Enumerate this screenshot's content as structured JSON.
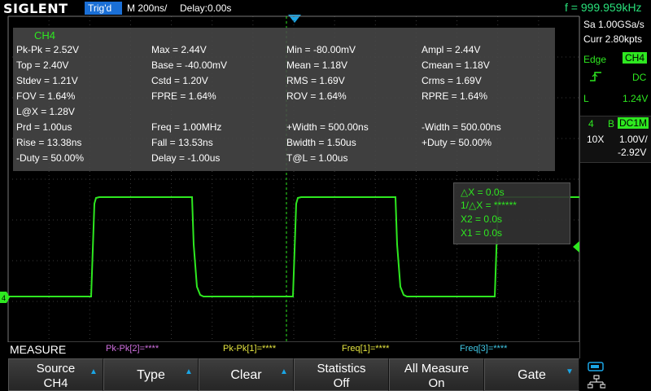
{
  "header": {
    "brand": "SIGLENT",
    "trigger_status": "Trig'd",
    "timebase": "M 200ns/",
    "delay": "Delay:0.00s",
    "frequency": "f = 999.959kHz"
  },
  "measurements": {
    "channel": "CH4",
    "rows": [
      [
        "Pk-Pk = 2.52V",
        "Max = 2.44V",
        "Min = -80.00mV",
        "Ampl = 2.44V"
      ],
      [
        "Top = 2.40V",
        "Base = -40.00mV",
        "Mean = 1.18V",
        "Cmean = 1.18V"
      ],
      [
        "Stdev = 1.21V",
        "Cstd = 1.20V",
        "RMS = 1.69V",
        "Crms = 1.69V"
      ],
      [
        "FOV = 1.64%",
        "FPRE = 1.64%",
        "ROV = 1.64%",
        "RPRE = 1.64%"
      ],
      [
        "L@X = 1.28V",
        "",
        "",
        ""
      ],
      [
        "Prd = 1.00us",
        "Freq = 1.00MHz",
        "+Width = 500.00ns",
        "-Width = 500.00ns"
      ],
      [
        "Rise = 13.38ns",
        "Fall = 13.53ns",
        "Bwidth = 1.50us",
        "+Duty = 50.00%"
      ],
      [
        "-Duty = 50.00%",
        "Delay = -1.00us",
        "T@L = 1.00us",
        ""
      ]
    ]
  },
  "cursors": {
    "delta_x": "△X = 0.0s",
    "inv_delta_x": "1/△X = ******",
    "x2": "X2 = 0.0s",
    "x1": "X1 = 0.0s"
  },
  "right_panel": {
    "sample_rate": "Sa 1.00GSa/s",
    "memory": "Curr 2.80kpts",
    "trigger_type": "Edge",
    "trigger_source": "CH4",
    "coupling": "DC",
    "level_label": "L",
    "level": "1.24V",
    "channel_number": "4",
    "bw_flag": "B",
    "channel_coupling": "DC1M",
    "probe": "10X",
    "volts_per_div": "1.00V/",
    "offset": "-2.92V"
  },
  "footer": {
    "menu_title": "MEASURE",
    "channel_readouts": [
      {
        "text": "Pk-Pk[2]=****",
        "color": "#d070e0"
      },
      {
        "text": "Pk-Pk[1]=****",
        "color": "#e6e640"
      },
      {
        "text": "Freq[1]=****",
        "color": "#e6e640"
      },
      {
        "text": "Freq[3]=****",
        "color": "#40c8e6"
      }
    ],
    "softkeys": [
      {
        "line1": "Source",
        "line2": "CH4",
        "arrow": "up"
      },
      {
        "line1": "Type",
        "line2": "",
        "arrow": "up"
      },
      {
        "line1": "Clear",
        "line2": "",
        "arrow": "up"
      },
      {
        "line1": "Statistics",
        "line2": "Off",
        "arrow": ""
      },
      {
        "line1": "All Measure",
        "line2": "On",
        "arrow": ""
      },
      {
        "line1": "Gate",
        "line2": "",
        "arrow": "down"
      }
    ]
  },
  "waveform": {
    "channel_marker": "4",
    "color": "#2ee820"
  },
  "colors": {
    "trace": "#2ee820",
    "accent_blue": "#1a6fd6",
    "cursor_green": "#2ee820"
  }
}
